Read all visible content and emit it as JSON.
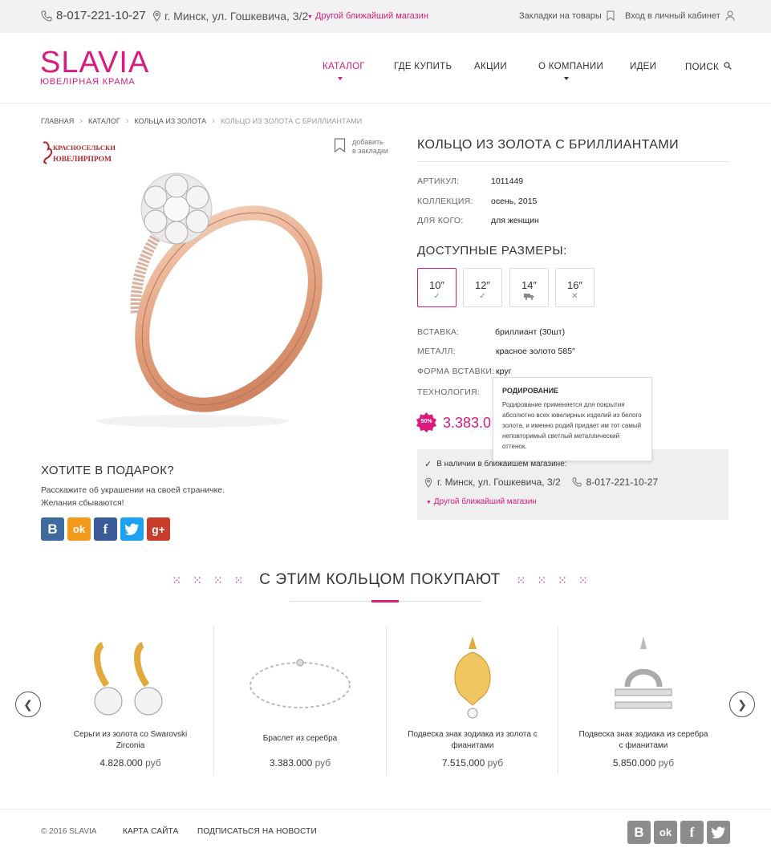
{
  "topbar": {
    "phone": "8-017-221-10-27",
    "address": "г. Минск, ул. Гошкевича, 3/2",
    "other_store": "Другой ближайший магазин",
    "bookmarks": "Закладки на товары",
    "login": "Вход в личный кабинет"
  },
  "brand": {
    "name": "SLAVIA",
    "tagline": "ЮВЕЛІРНАЯ КРАМА",
    "accent": "#d81b7c"
  },
  "nav": [
    "КАТАЛОГ",
    "ГДЕ КУПИТЬ",
    "АКЦИИ",
    "О КОМПАНИИ",
    "ИДЕИ",
    "ПОИСК"
  ],
  "breadcrumb": [
    "ГЛАВНАЯ",
    "КАТАЛОГ",
    "КОЛЬЦА ИЗ ЗОЛОТА",
    "КОЛЬЦО ИЗ ЗОЛОТА С БРИЛЛИАНТАМИ"
  ],
  "maker_logo": "КРАСНОСЕЛЬСКИЙ ЮВЕЛИРПРОМ",
  "bookmark_add": {
    "line1": "добавить",
    "line2": "в закладки"
  },
  "product": {
    "title": "КОЛЬЦО ИЗ ЗОЛОТА С БРИЛЛИАНТАМИ",
    "specs": [
      {
        "label": "АРТИКУЛ:",
        "value": "1011449"
      },
      {
        "label": "КОЛЛЕКЦИЯ:",
        "value": "осень, 2015"
      },
      {
        "label": "ДЛЯ КОГО:",
        "value": "для женщин"
      }
    ],
    "sizes_title": "ДОСТУПНЫЕ РАЗМЕРЫ:",
    "sizes": [
      {
        "value": "10″",
        "status": "check-icon"
      },
      {
        "value": "12″",
        "status": "check-icon"
      },
      {
        "value": "14″",
        "status": "truck-icon"
      },
      {
        "value": "16″",
        "status": "cross-icon"
      }
    ],
    "details": [
      {
        "label": "ВСТАВКА:",
        "value": "бриллиант (30шт)"
      },
      {
        "label": "МЕТАЛЛ:",
        "value": "красное золото 585″"
      },
      {
        "label": "ФОРМА ВСТАВКИ:",
        "value": "круг"
      },
      {
        "label": "ТЕХНОЛОГИЯ:",
        "value": ""
      }
    ],
    "discount": "50%",
    "price": "3.383.0"
  },
  "tooltip": {
    "title": "РОДИРОВАНИЕ",
    "text": "Родирование применяется для покрытия абсолютно всех ювелирных изделий из белого золота, и именно родий придает им тот самый неповторимый светлый металлический оттенок."
  },
  "stock": {
    "status": "В наличии в ближайшем магазине:",
    "address": "г. Минск, ул. Гошкевича, 3/2",
    "phone": "8-017-221-10-27",
    "other": "Другой ближайший магазин"
  },
  "gift": {
    "title": "ХОТИТЕ В ПОДАРОК?",
    "line1": "Расскажите об украшении на своей страничке.",
    "line2": "Желания сбываются!"
  },
  "social": [
    {
      "name": "vk-icon",
      "glyph": "B",
      "color": "#3f6aa0"
    },
    {
      "name": "ok-icon",
      "glyph": "ok",
      "color": "#f39a1d"
    },
    {
      "name": "facebook-icon",
      "glyph": "f",
      "color": "#3b5a9a"
    },
    {
      "name": "twitter-icon",
      "glyph": "t",
      "color": "#1da1f2"
    },
    {
      "name": "gplus-icon",
      "glyph": "g+",
      "color": "#c83d2a"
    }
  ],
  "also": {
    "title": "С ЭТИМ КОЛЬЦОМ ПОКУПАЮТ",
    "items": [
      {
        "name": "Серьги из золота со Swarovski Zirconia",
        "price": "4.828.000",
        "currency": "руб"
      },
      {
        "name": "Браслет из серебра",
        "price": "3.383.000",
        "currency": "руб"
      },
      {
        "name": "Подвеска знак зодиака из золота с фианитами",
        "price": "7.515.000",
        "currency": "руб"
      },
      {
        "name": "Подвеска знак зодиака из серебра с фианитами",
        "price": "5.850.000",
        "currency": "руб"
      }
    ]
  },
  "footer": {
    "copyright": "© 2016 SLAVIA",
    "sitemap": "КАРТА САЙТА",
    "subscribe": "ПОДПИСАТЬСЯ НА НОВОСТИ"
  }
}
